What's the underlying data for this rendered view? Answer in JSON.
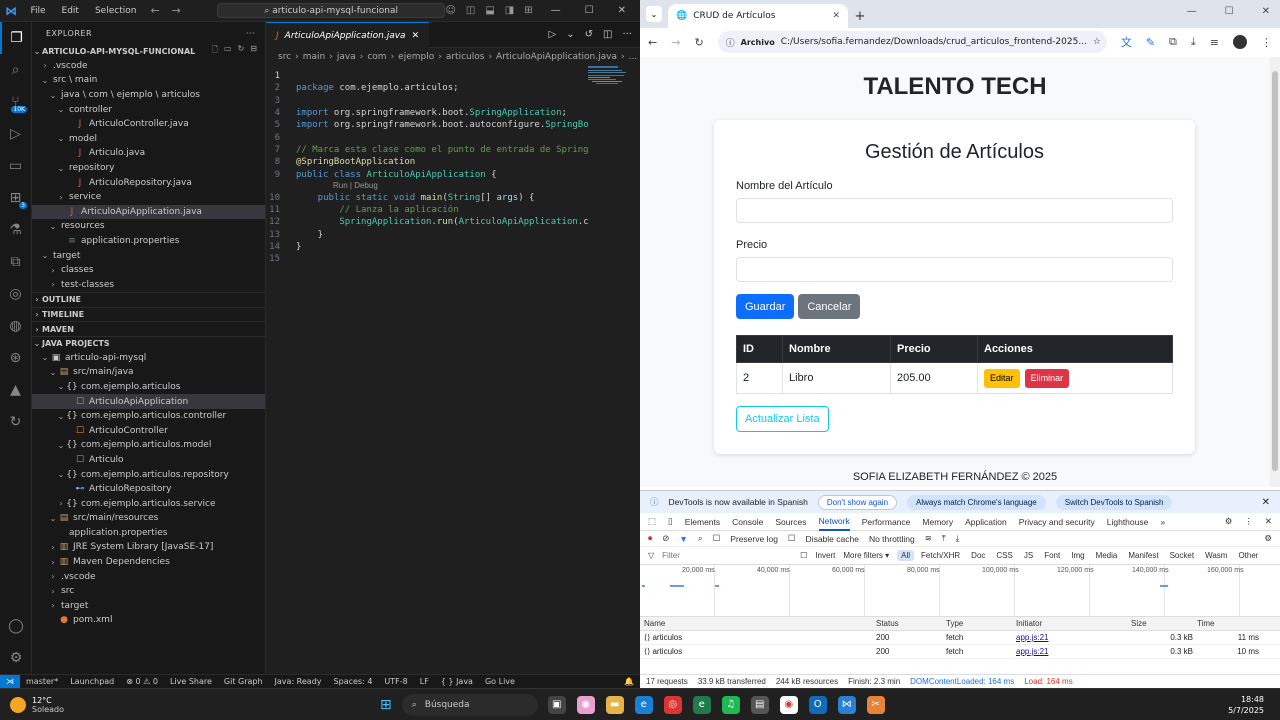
{
  "vscode": {
    "menu": [
      "File",
      "Edit",
      "Selection"
    ],
    "search": "articulo-api-mysql-funcional",
    "explorer_title": "EXPLORER",
    "project_title": "ARTICULO-API-MYSQL-FUNCIONAL",
    "tree": [
      {
        "label": ".vscode",
        "indent": 1,
        "chev": "›",
        "icon": "",
        "cls": ""
      },
      {
        "label": "src \\ main",
        "indent": 1,
        "chev": "⌄",
        "icon": "",
        "cls": ""
      },
      {
        "label": "java \\ com \\ ejemplo \\ articulos",
        "indent": 2,
        "chev": "⌄",
        "icon": "",
        "cls": ""
      },
      {
        "label": "controller",
        "indent": 3,
        "chev": "⌄",
        "icon": "",
        "cls": ""
      },
      {
        "label": "ArticuloController.java",
        "indent": 4,
        "chev": "",
        "icon": "J",
        "cls": "java"
      },
      {
        "label": "model",
        "indent": 3,
        "chev": "⌄",
        "icon": "",
        "cls": ""
      },
      {
        "label": "Articulo.java",
        "indent": 4,
        "chev": "",
        "icon": "J",
        "cls": "java"
      },
      {
        "label": "repository",
        "indent": 3,
        "chev": "⌄",
        "icon": "",
        "cls": ""
      },
      {
        "label": "ArticuloRepository.java",
        "indent": 4,
        "chev": "",
        "icon": "J",
        "cls": "java"
      },
      {
        "label": "service",
        "indent": 3,
        "chev": "›",
        "icon": "",
        "cls": ""
      },
      {
        "label": "ArticuloApiApplication.java",
        "indent": 3,
        "chev": "",
        "icon": "J",
        "cls": "java",
        "sel": true
      },
      {
        "label": "resources",
        "indent": 2,
        "chev": "⌄",
        "icon": "",
        "cls": ""
      },
      {
        "label": "application.properties",
        "indent": 3,
        "chev": "",
        "icon": "≡",
        "cls": "cfg"
      },
      {
        "label": "target",
        "indent": 1,
        "chev": "⌄",
        "icon": "",
        "cls": ""
      },
      {
        "label": "classes",
        "indent": 2,
        "chev": "›",
        "icon": "",
        "cls": ""
      },
      {
        "label": "test-classes",
        "indent": 2,
        "chev": "›",
        "icon": "",
        "cls": ""
      }
    ],
    "sections": [
      "OUTLINE",
      "TIMELINE",
      "MAVEN",
      "JAVA PROJECTS"
    ],
    "java_projects": [
      {
        "label": "articulo-api-mysql",
        "indent": 1,
        "chev": "⌄",
        "icon": "▣",
        "cls": "pkg"
      },
      {
        "label": "src/main/java",
        "indent": 2,
        "chev": "⌄",
        "icon": "▤",
        "cls": "folder"
      },
      {
        "label": "com.ejemplo.articulos",
        "indent": 3,
        "chev": "⌄",
        "icon": "{}",
        "cls": "pkg"
      },
      {
        "label": "ArticuloApiApplication",
        "indent": 4,
        "chev": "",
        "icon": "☐",
        "cls": "cls",
        "sel": true
      },
      {
        "label": "com.ejemplo.articulos.controller",
        "indent": 3,
        "chev": "⌄",
        "icon": "{}",
        "cls": "pkg"
      },
      {
        "label": "ArticuloController",
        "indent": 4,
        "chev": "",
        "icon": "☐",
        "cls": "cls"
      },
      {
        "label": "com.ejemplo.articulos.model",
        "indent": 3,
        "chev": "⌄",
        "icon": "{}",
        "cls": "pkg"
      },
      {
        "label": "Articulo",
        "indent": 4,
        "chev": "",
        "icon": "☐",
        "cls": "cls"
      },
      {
        "label": "com.ejemplo.articulos.repository",
        "indent": 3,
        "chev": "⌄",
        "icon": "{}",
        "cls": "pkg"
      },
      {
        "label": "ArticuloRepository",
        "indent": 4,
        "chev": "",
        "icon": "⊷",
        "cls": "iface"
      },
      {
        "label": "com.ejemplo.articulos.service",
        "indent": 3,
        "chev": "›",
        "icon": "{}",
        "cls": "pkg"
      },
      {
        "label": "src/main/resources",
        "indent": 2,
        "chev": "⌄",
        "icon": "▤",
        "cls": "folder"
      },
      {
        "label": "application.properties",
        "indent": 3,
        "chev": "",
        "icon": "",
        "cls": ""
      },
      {
        "label": "JRE System Library [JavaSE-17]",
        "indent": 2,
        "chev": "›",
        "icon": "▥",
        "cls": "folder"
      },
      {
        "label": "Maven Dependencies",
        "indent": 2,
        "chev": "›",
        "icon": "▥",
        "cls": "folder"
      },
      {
        "label": ".vscode",
        "indent": 2,
        "chev": "›",
        "icon": "",
        "cls": ""
      },
      {
        "label": "src",
        "indent": 2,
        "chev": "›",
        "icon": "",
        "cls": ""
      },
      {
        "label": "target",
        "indent": 2,
        "chev": "›",
        "icon": "",
        "cls": ""
      },
      {
        "label": "pom.xml",
        "indent": 2,
        "chev": "",
        "icon": "●",
        "cls": "xml"
      }
    ],
    "tab_label": "ArticuloApiApplication.java",
    "breadcrumb": [
      "src",
      "main",
      "java",
      "com",
      "ejemplo",
      "articulos",
      "ArticuloApiApplication.java",
      "..."
    ],
    "codelens": "Run | Debug",
    "status": [
      "master*",
      "Launchpad",
      "⊗ 0 ⚠ 0",
      "Live Share",
      "Git Graph",
      "Java: Ready",
      "Spaces: 4",
      "UTF-8",
      "LF",
      "{ } Java",
      "Go Live"
    ]
  },
  "chrome": {
    "tab_title": "CRUD de Artículos",
    "omni_chip": "Archivo",
    "url": "C:/Users/sofia.fernandez/Downloads/crud_articulos_frontend-2025...",
    "brand": "TALENTO TECH",
    "card_title": "Gestión de Artículos",
    "label_nombre": "Nombre del Artículo",
    "label_precio": "Precio",
    "btn_guardar": "Guardar",
    "btn_cancelar": "Cancelar",
    "table_headers": [
      "ID",
      "Nombre",
      "Precio",
      "Acciones"
    ],
    "rows": [
      {
        "id": "2",
        "nombre": "Libro",
        "precio": "205.00"
      }
    ],
    "btn_editar": "Editar",
    "btn_eliminar": "Eliminar",
    "btn_actualizar": "Actualizar Lista",
    "footer": "SOFIA ELIZABETH FERNÁNDEZ © 2025"
  },
  "devtools": {
    "info": "DevTools is now available in Spanish",
    "dont_show": "Don't show again",
    "match": "Always match Chrome's language",
    "switch": "Switch DevTools to Spanish",
    "tabs": [
      "Elements",
      "Console",
      "Sources",
      "Network",
      "Performance",
      "Memory",
      "Application",
      "Privacy and security",
      "Lighthouse"
    ],
    "preserve_log": "Preserve log",
    "disable_cache": "Disable cache",
    "throttling": "No throttling",
    "filter_placeholder": "Filter",
    "invert": "Invert",
    "more_filters": "More filters ▾",
    "filter_types": [
      "All",
      "Fetch/XHR",
      "Doc",
      "CSS",
      "JS",
      "Font",
      "Img",
      "Media",
      "Manifest",
      "Socket",
      "Wasm",
      "Other"
    ],
    "ticks": [
      "20,000 ms",
      "40,000 ms",
      "60,000 ms",
      "80,000 ms",
      "100,000 ms",
      "120,000 ms",
      "140,000 ms",
      "160,000 ms"
    ],
    "columns": [
      "Name",
      "Status",
      "Type",
      "Initiator",
      "Size",
      "Time"
    ],
    "requests": [
      {
        "name": "articulos",
        "status": "200",
        "type": "fetch",
        "initiator": "app.js:21",
        "size": "0.3 kB",
        "time": "11 ms"
      },
      {
        "name": "articulos",
        "status": "200",
        "type": "fetch",
        "initiator": "app.js:21",
        "size": "0.3 kB",
        "time": "10 ms"
      }
    ],
    "summary": {
      "requests": "17 requests",
      "transferred": "33.9 kB transferred",
      "resources": "244 kB resources",
      "finish": "Finish: 2.3 min",
      "dcl": "DOMContentLoaded: 164 ms",
      "load": "Load: 164 ms"
    }
  },
  "taskbar": {
    "temp": "12°C",
    "weather": "Soleado",
    "search": "Búsqueda",
    "time": "18:48",
    "date": "5/7/2025"
  }
}
